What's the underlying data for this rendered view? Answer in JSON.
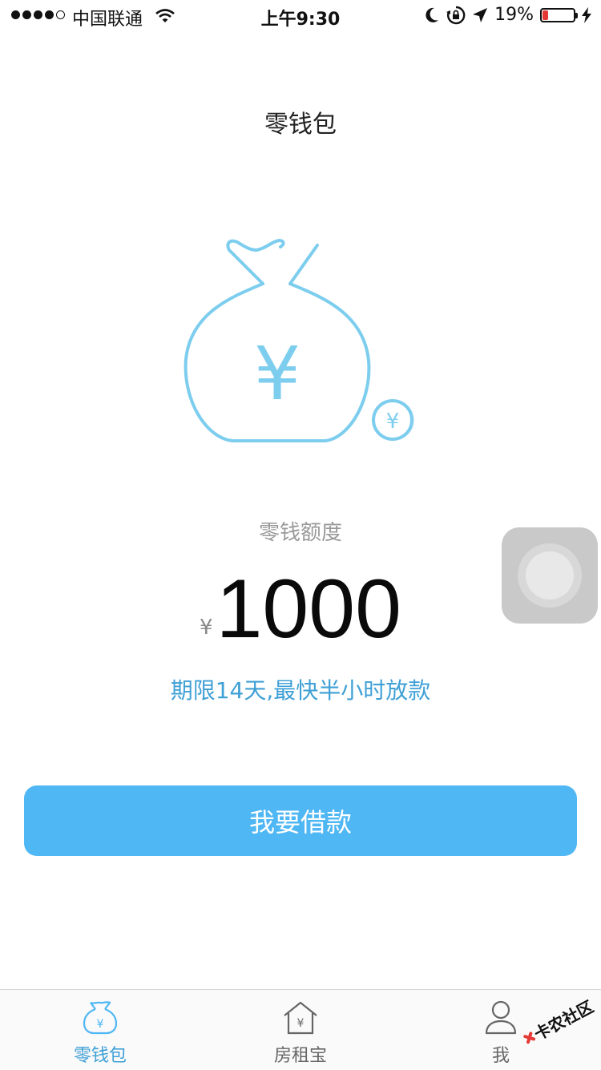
{
  "status_bar": {
    "carrier": "中国联通",
    "time": "上午9:30",
    "battery_percent": "19%",
    "battery_level": 0.19,
    "icons": [
      "signal-dots",
      "wifi-icon",
      "moon-icon",
      "rotation-lock-icon",
      "location-arrow-icon",
      "battery-icon",
      "charging-bolt-icon"
    ]
  },
  "header": {
    "title": "零钱包"
  },
  "illustration": {
    "icon": "money-bag-icon",
    "bag_symbol": "¥",
    "coin_symbol": "¥",
    "color": "#7dcdee"
  },
  "quota": {
    "label": "零钱额度",
    "currency": "¥",
    "amount": "1000",
    "term_text": "期限14天,最快半小时放款"
  },
  "actions": {
    "borrow_label": "我要借款"
  },
  "tab_bar": {
    "tabs": [
      {
        "label": "零钱包",
        "icon": "money-bag-icon",
        "active": true
      },
      {
        "label": "房租宝",
        "icon": "house-yen-icon",
        "active": false
      },
      {
        "label": "我",
        "icon": "person-icon",
        "active": false
      }
    ]
  },
  "watermark": {
    "text": "卡农社区"
  },
  "colors": {
    "accent": "#4fb7f4",
    "link_blue": "#3fa0d6",
    "illustration": "#7dcdee",
    "battery_low": "#e53935"
  }
}
